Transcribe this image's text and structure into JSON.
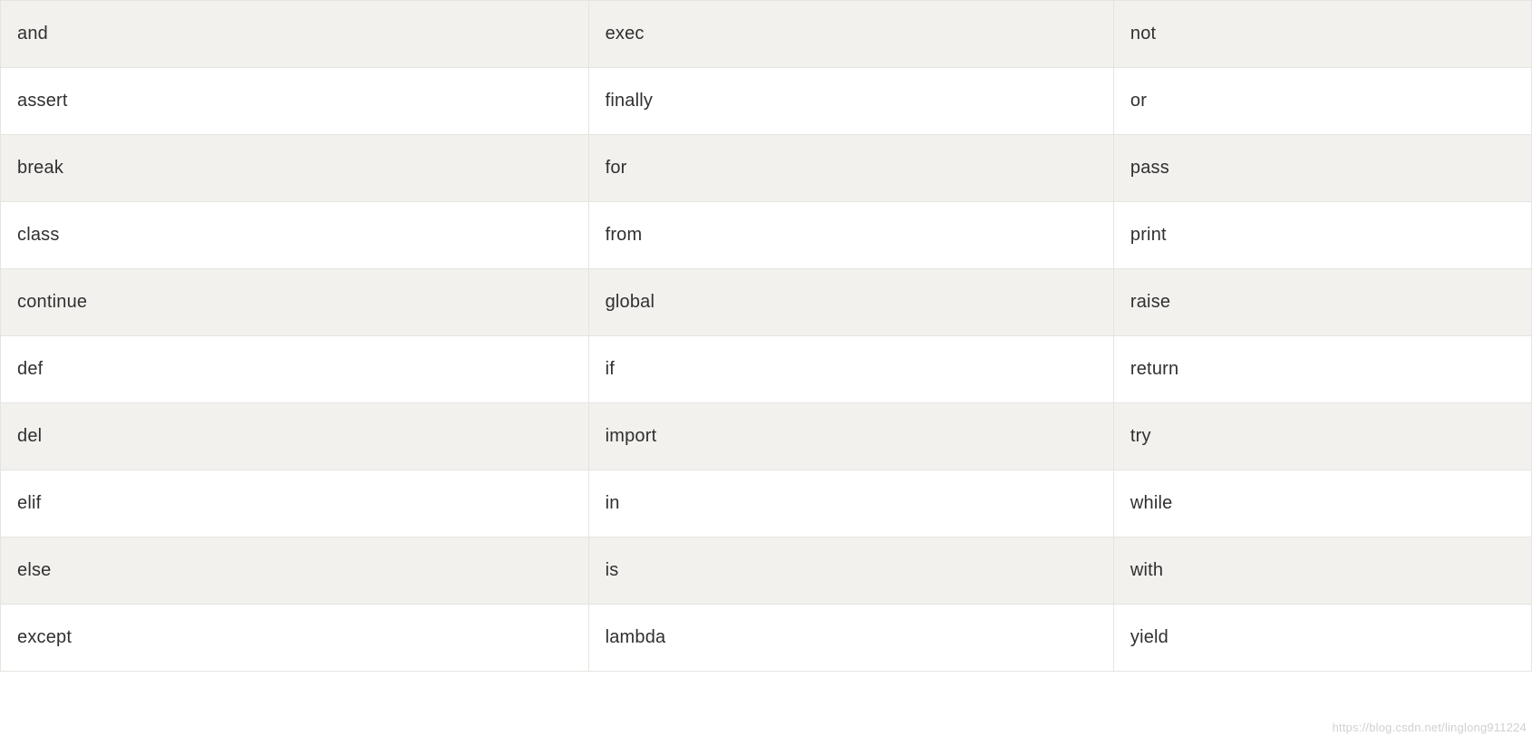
{
  "table": {
    "rows": [
      {
        "c1": "and",
        "c2": "exec",
        "c3": "not"
      },
      {
        "c1": "assert",
        "c2": "finally",
        "c3": "or"
      },
      {
        "c1": "break",
        "c2": "for",
        "c3": "pass"
      },
      {
        "c1": "class",
        "c2": "from",
        "c3": "print"
      },
      {
        "c1": "continue",
        "c2": "global",
        "c3": "raise"
      },
      {
        "c1": "def",
        "c2": "if",
        "c3": "return"
      },
      {
        "c1": "del",
        "c2": "import",
        "c3": "try"
      },
      {
        "c1": "elif",
        "c2": "in",
        "c3": "while"
      },
      {
        "c1": "else",
        "c2": "is",
        "c3": "with"
      },
      {
        "c1": "except",
        "c2": "lambda",
        "c3": "yield"
      }
    ]
  },
  "watermark": "https://blog.csdn.net/linglong911224"
}
